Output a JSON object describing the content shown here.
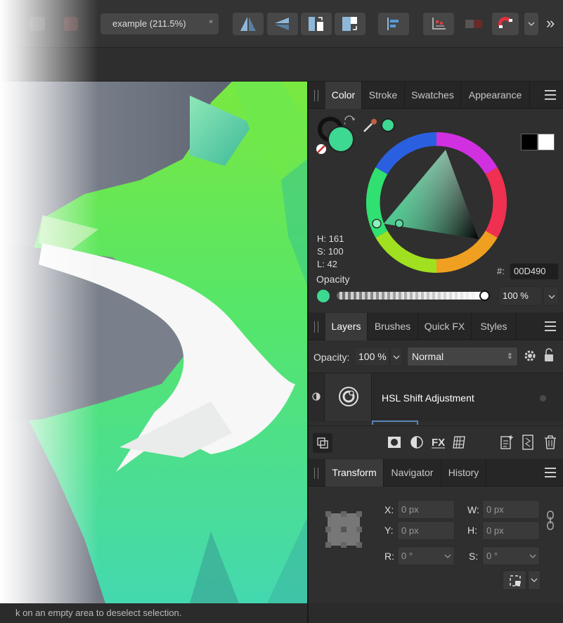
{
  "document": {
    "tab_label": "example (211.5%)",
    "modified_mark": "*"
  },
  "toolbar": {
    "icons": [
      "flip-horizontal-icon",
      "flip-vertical-icon",
      "rotate-left-icon",
      "rotate-right-icon",
      "align-left-icon",
      "snapping-grid-icon",
      "toggle-icon",
      "magnet-icon",
      "chevron-down-icon",
      "overflow-icon"
    ],
    "overflow_label": "»"
  },
  "color_panel": {
    "tabs": [
      "Color",
      "Stroke",
      "Swatches",
      "Appearance"
    ],
    "active_tab": "Color",
    "h_label": "H: 161",
    "s_label": "S: 100",
    "l_label": "L: 42",
    "hex_label": "#:",
    "hex_value": "00D490",
    "opacity_label": "Opacity",
    "opacity_value": "100 %",
    "fill_color": "#3dd891",
    "opacity_fraction": 1.0
  },
  "layers_panel": {
    "tabs": [
      "Layers",
      "Brushes",
      "Quick FX",
      "Styles"
    ],
    "active_tab": "Layers",
    "opacity_label": "Opacity:",
    "opacity_value": "100 %",
    "blend_mode": "Normal",
    "layers": [
      {
        "name": "HSL Shift Adjustment"
      }
    ]
  },
  "transform_panel": {
    "tabs": [
      "Transform",
      "Navigator",
      "History"
    ],
    "active_tab": "Transform",
    "x_label": "X:",
    "x_value": "0 px",
    "y_label": "Y:",
    "y_value": "0 px",
    "w_label": "W:",
    "w_value": "0 px",
    "h_label": "H:",
    "h_value": "0 px",
    "r_label": "R:",
    "r_value": "0 °",
    "s_label": "S:",
    "s_value": "0 °"
  },
  "status": {
    "text": "k on an empty area to deselect selection."
  }
}
